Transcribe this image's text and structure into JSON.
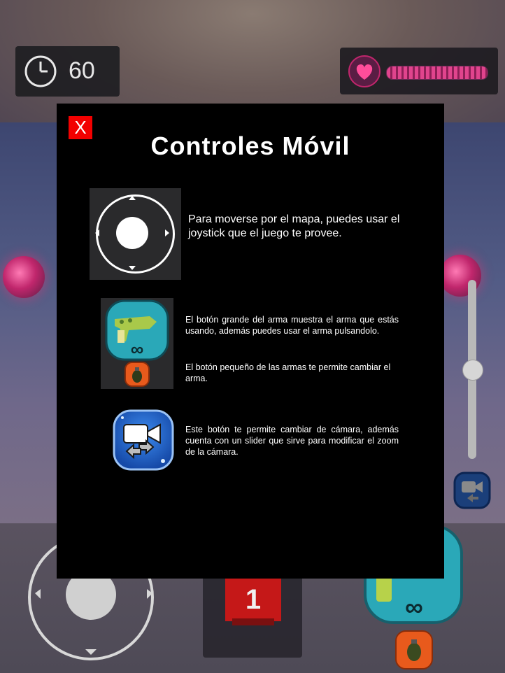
{
  "hud": {
    "timer_value": "60",
    "health_level": 1.0,
    "zoom_level": 0.5,
    "score_digit": "1"
  },
  "modal": {
    "close_label": "X",
    "title": "Controles Móvil",
    "joystick_text": "Para moverse por el mapa, puedes usar el joystick que el juego te provee.",
    "weapon_text_1": "El botón grande del arma muestra el arma que estás usando, además puedes usar el arma pulsandolo.",
    "weapon_text_2": "El botón pequeño de las armas te permite cambiar el arma.",
    "camera_text": "Este botón te permite cambiar de cámara, además cuenta con un slider que sirve para modificar el zoom de la cámara.",
    "ammo_symbol": "∞"
  },
  "colors": {
    "close_button": "#f20000",
    "health_fill": "#e0448d",
    "camera_button": "#1e63c8",
    "weapon_button": "#2aa8b8",
    "grenade_button": "#e85a1c"
  },
  "icons": [
    "clock-icon",
    "heart-icon",
    "joystick-icon",
    "weapon-icon",
    "grenade-icon",
    "camera-switch-icon"
  ]
}
